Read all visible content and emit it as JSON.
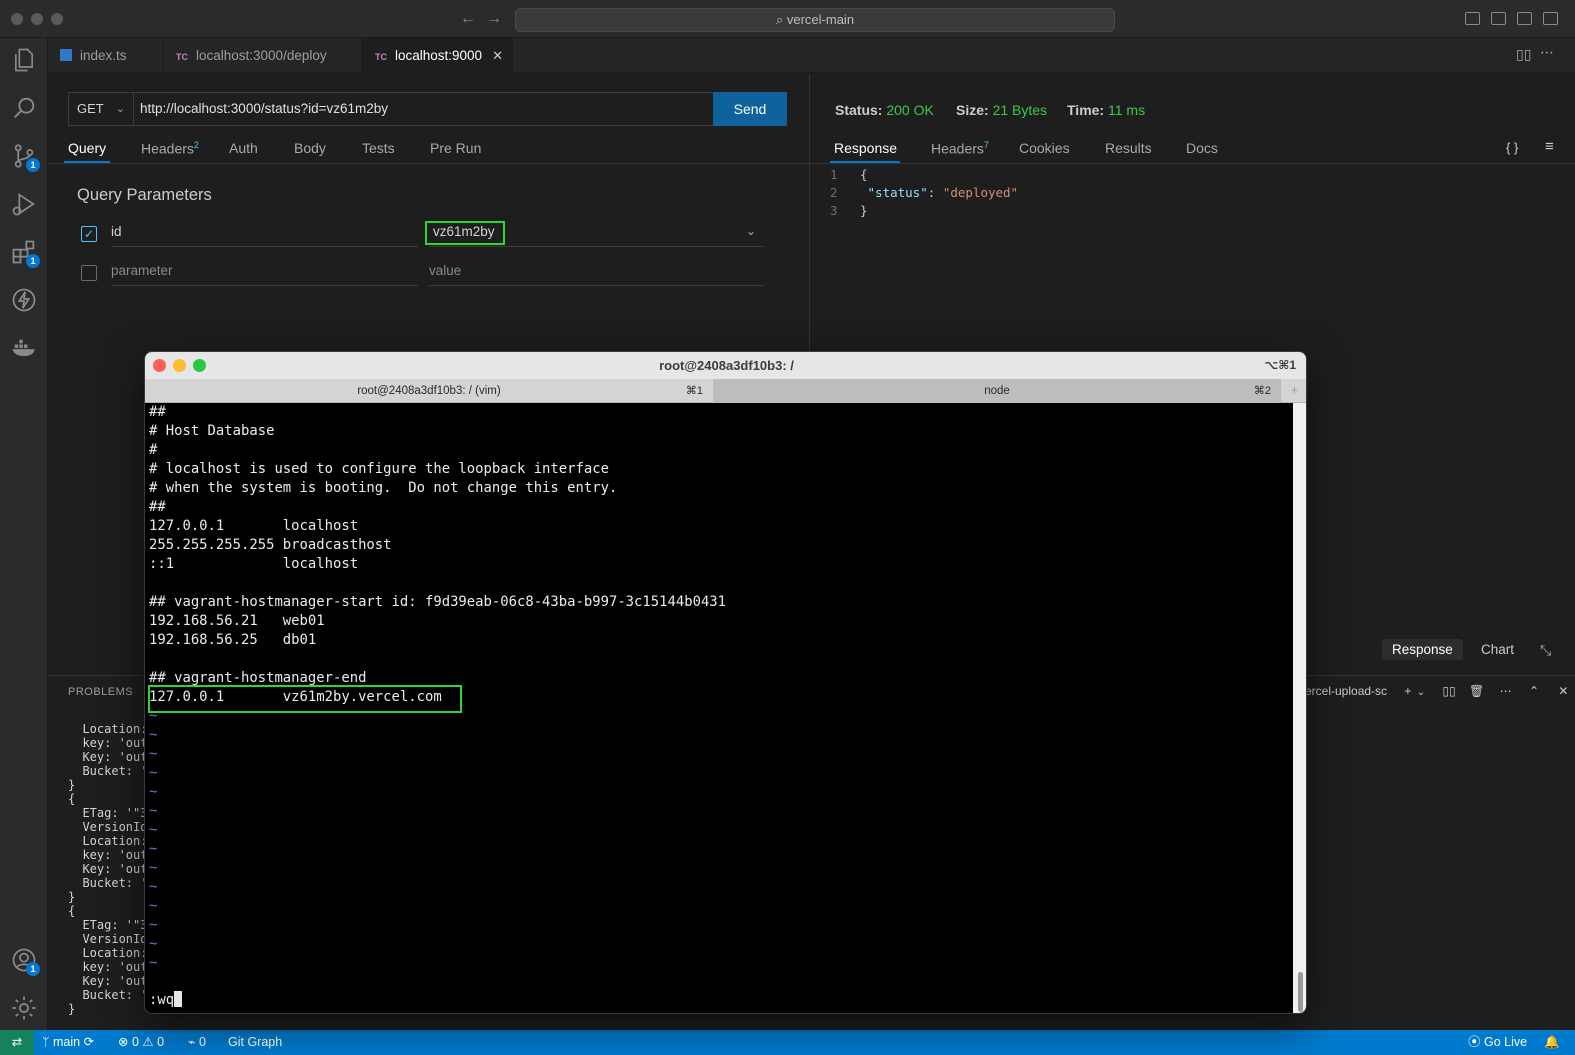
{
  "window": {
    "search_text": "vercel-main"
  },
  "tabs": [
    {
      "icon": "",
      "label": "index.ts"
    },
    {
      "icon": "TC",
      "label": "localhost:3000/deploy"
    },
    {
      "icon": "TC",
      "label": "localhost:9000",
      "close": "✕"
    }
  ],
  "activity_badges": {
    "source_control": "1",
    "extensions": "1",
    "accounts": "1"
  },
  "request": {
    "method": "GET",
    "url": "http://localhost:3000/status?id=vz61m2by",
    "send_label": "Send",
    "tabs": [
      "Query",
      "Headers",
      "Auth",
      "Body",
      "Tests",
      "Pre Run"
    ],
    "headers_count": "2",
    "query_title": "Query Parameters",
    "params": [
      {
        "checked": true,
        "name": "id",
        "value": "vz61m2by"
      },
      {
        "checked": false,
        "name": "parameter",
        "value": "value"
      }
    ]
  },
  "response": {
    "status_label": "Status:",
    "status_value": "200 OK",
    "size_label": "Size:",
    "size_value": "21 Bytes",
    "time_label": "Time:",
    "time_value": "11 ms",
    "tabs": [
      "Response",
      "Headers",
      "Cookies",
      "Results",
      "Docs"
    ],
    "headers_count": "7",
    "body_lines": [
      {
        "ln": "1",
        "text": "{"
      },
      {
        "ln": "2",
        "key": "\"status\"",
        "value": "\"deployed\""
      },
      {
        "ln": "3",
        "text": "}"
      }
    ],
    "view_buttons": [
      "Response",
      "Chart"
    ]
  },
  "bottom_panel": {
    "problems_label": "PROBLEMS",
    "terminal_name": "ercel-upload-sc",
    "logs": [
      "  Location:",
      "  key: 'out",
      "  Key: 'out",
      "  Bucket: '",
      "}",
      "{",
      "  ETag: '\"3",
      "  VersionId",
      "  Location:",
      "  key: 'out",
      "  Key: 'out",
      "  Bucket: '",
      "}",
      "{",
      "  ETag: '\"3",
      "  VersionId",
      "  Location:",
      "  key: 'out",
      "  Key: 'out",
      "  Bucket: '",
      "}"
    ]
  },
  "terminal": {
    "title": "root@2408a3df10b3: /",
    "shortcut": "⌥⌘1",
    "tabs": [
      {
        "label": "root@2408a3df10b3: / (vim)",
        "key": "⌘1"
      },
      {
        "label": "node",
        "key": "⌘2"
      }
    ],
    "lines": [
      "##",
      "# Host Database",
      "#",
      "# localhost is used to configure the loopback interface",
      "# when the system is booting.  Do not change this entry.",
      "##",
      "127.0.0.1       localhost",
      "255.255.255.255 broadcasthost",
      "::1             localhost",
      "",
      "## vagrant-hostmanager-start id: f9d39eab-06c8-43ba-b997-3c15144b0431",
      "192.168.56.21   web01",
      "192.168.56.25   db01",
      "",
      "## vagrant-hostmanager-end",
      "127.0.0.1       vz61m2by.vercel.com"
    ],
    "tilde_count": 14,
    "command": ":wq"
  },
  "statusbar": {
    "branch": "main",
    "errors": "0",
    "warnings": "0",
    "ports": "0",
    "git_graph": "Git Graph",
    "go_live": "Go Live"
  }
}
